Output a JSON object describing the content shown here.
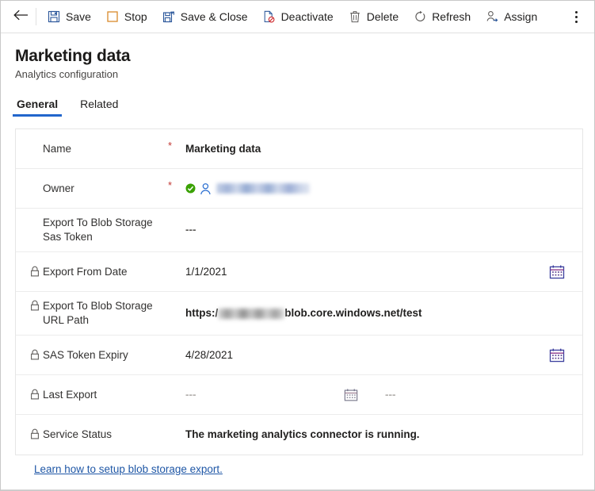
{
  "commandbar": {
    "back_label": "Back",
    "back_icon": "arrow-left-icon",
    "overflow_icon": "more-vertical-icon",
    "items": [
      {
        "label": "Save",
        "icon": "save-floppy-icon"
      },
      {
        "label": "Stop",
        "icon": "stop-square-icon"
      },
      {
        "label": "Save & Close",
        "icon": "save-and-close-icon"
      },
      {
        "label": "Deactivate",
        "icon": "deactivate-document-icon"
      },
      {
        "label": "Delete",
        "icon": "trash-icon"
      },
      {
        "label": "Refresh",
        "icon": "refresh-circular-arrow-icon"
      },
      {
        "label": "Assign",
        "icon": "assign-person-icon"
      }
    ]
  },
  "header": {
    "title": "Marketing data",
    "subtitle": "Analytics configuration"
  },
  "tabs": [
    {
      "label": "General",
      "active": true
    },
    {
      "label": "Related",
      "active": false
    }
  ],
  "form": {
    "rows": [
      {
        "label": "Name",
        "required": "*",
        "value": "Marketing data",
        "locked": false
      },
      {
        "label": "Owner",
        "required": "*",
        "value": "",
        "locked": false,
        "status_icon": "green-check-circle-icon",
        "person_icon": "person-icon",
        "value_redacted": true
      },
      {
        "label": "Export To Blob Storage Sas Token",
        "required": "",
        "value": "---",
        "locked": false
      },
      {
        "label": "Export From Date",
        "required": "",
        "value": "1/1/2021",
        "locked": true,
        "lock_icon": "lock-icon",
        "calendar_icon": "calendar-icon"
      },
      {
        "label": "Export To Blob Storage URL Path",
        "required": "",
        "value_prefix": "https:/",
        "value_suffix": "blob.core.windows.net/test",
        "locked": true,
        "lock_icon": "lock-icon",
        "value_redacted": true
      },
      {
        "label": "SAS Token Expiry",
        "required": "",
        "value": "4/28/2021",
        "locked": true,
        "lock_icon": "lock-icon",
        "calendar_icon": "calendar-icon"
      },
      {
        "label": "Last Export",
        "required": "",
        "value": "---",
        "value_2": "---",
        "locked": true,
        "lock_icon": "lock-icon",
        "calendar_icon": "calendar-icon-disabled"
      },
      {
        "label": "Service Status",
        "required": "",
        "value": "The marketing analytics connector is running.",
        "locked": true,
        "lock_icon": "lock-icon"
      }
    ]
  },
  "footer": {
    "link_label": "Learn how to setup blob storage export."
  },
  "colors": {
    "accent": "#2266cc",
    "link": "#1f57a6",
    "required": "#c23934",
    "success": "#3aa103",
    "icon_blue": "#2b579a",
    "icon_orange": "#d98a2b",
    "icon_red": "#d13438",
    "text": "#201f1e",
    "label_text": "#323130",
    "border": "#e6e6e6"
  }
}
